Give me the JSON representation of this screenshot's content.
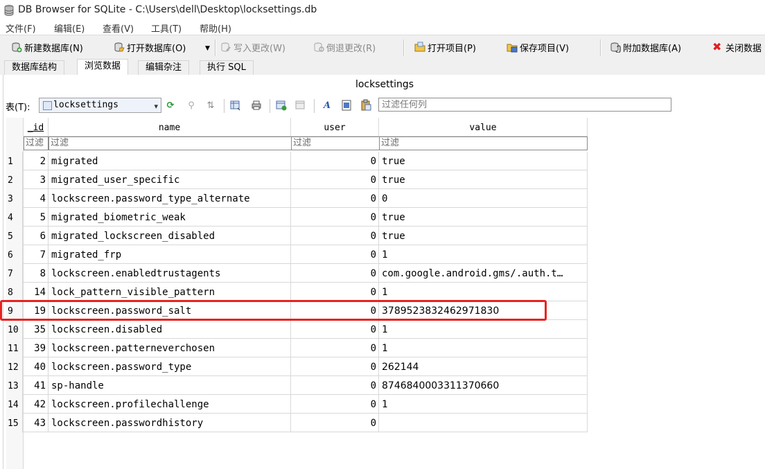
{
  "window": {
    "title": "DB Browser for SQLite - C:\\Users\\dell\\Desktop\\locksettings.db"
  },
  "menu": [
    "文件(F)",
    "编辑(E)",
    "查看(V)",
    "工具(T)",
    "帮助(H)"
  ],
  "toolbar": {
    "new_db": "新建数据库(N)",
    "open_db": "打开数据库(O)",
    "write_changes": "写入更改(W)",
    "revert_changes": "倒退更改(R)",
    "open_project": "打开项目(P)",
    "save_project": "保存项目(V)",
    "attach_db": "附加数据库(A)",
    "close_db": "关闭数据"
  },
  "tabs": [
    "数据库结构",
    "浏览数据",
    "编辑杂注",
    "执行 SQL"
  ],
  "panel_title": "locksettings",
  "filterbar": {
    "table_label": "表(T):",
    "table_name": "locksettings",
    "filter_placeholder": "过滤任何列"
  },
  "columns": [
    "_id",
    "name",
    "user",
    "value"
  ],
  "column_filter_placeholder": "过滤",
  "rows": [
    {
      "rn": "1",
      "id": "2",
      "name": "migrated",
      "user": "0",
      "value": "true"
    },
    {
      "rn": "2",
      "id": "3",
      "name": "migrated_user_specific",
      "user": "0",
      "value": "true"
    },
    {
      "rn": "3",
      "id": "4",
      "name": "lockscreen.password_type_alternate",
      "user": "0",
      "value": "0"
    },
    {
      "rn": "4",
      "id": "5",
      "name": "migrated_biometric_weak",
      "user": "0",
      "value": "true"
    },
    {
      "rn": "5",
      "id": "6",
      "name": "migrated_lockscreen_disabled",
      "user": "0",
      "value": "true"
    },
    {
      "rn": "6",
      "id": "7",
      "name": "migrated_frp",
      "user": "0",
      "value": "1"
    },
    {
      "rn": "7",
      "id": "8",
      "name": "lockscreen.enabledtrustagents",
      "user": "0",
      "value": "com.google.android.gms/.auth.t…"
    },
    {
      "rn": "8",
      "id": "14",
      "name": "lock_pattern_visible_pattern",
      "user": "0",
      "value": "1"
    },
    {
      "rn": "9",
      "id": "19",
      "name": "lockscreen.password_salt",
      "user": "0",
      "value": "3789523832462971830"
    },
    {
      "rn": "10",
      "id": "35",
      "name": "lockscreen.disabled",
      "user": "0",
      "value": "1"
    },
    {
      "rn": "11",
      "id": "39",
      "name": "lockscreen.patterneverchosen",
      "user": "0",
      "value": "1"
    },
    {
      "rn": "12",
      "id": "40",
      "name": "lockscreen.password_type",
      "user": "0",
      "value": "262144"
    },
    {
      "rn": "13",
      "id": "41",
      "name": "sp-handle",
      "user": "0",
      "value": "8746840003311370660"
    },
    {
      "rn": "14",
      "id": "42",
      "name": "lockscreen.profilechallenge",
      "user": "0",
      "value": "1"
    },
    {
      "rn": "15",
      "id": "43",
      "name": "lockscreen.passwordhistory",
      "user": "0",
      "value": ""
    }
  ],
  "highlight_row": "9",
  "colors": {
    "highlight": "#e8221f",
    "accent": "#2a6ebb"
  }
}
